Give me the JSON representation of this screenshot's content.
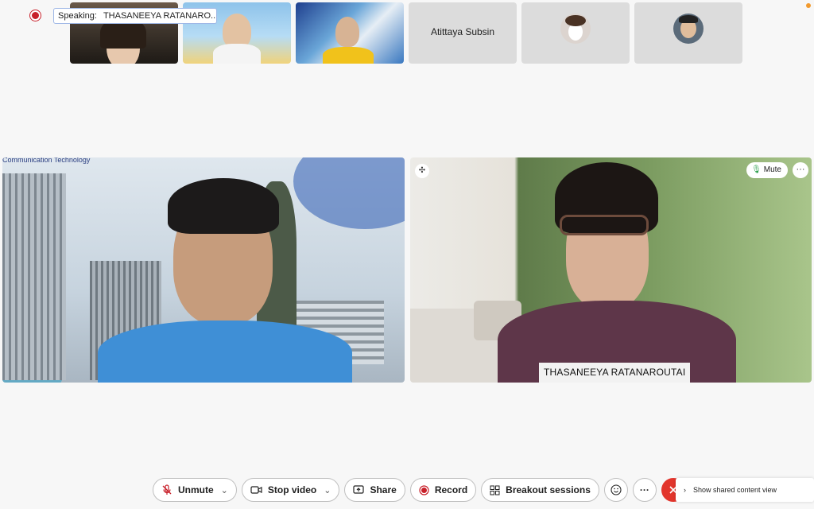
{
  "app": {
    "recording_indicator": "record-dot-icon",
    "accent_color": "#c8202a",
    "end_color": "#e2352c"
  },
  "speaking": {
    "label": "Speaking:",
    "name": "THASANEEYA RATANARO..."
  },
  "filmstrip": {
    "tiles": [
      {
        "type": "video"
      },
      {
        "type": "video"
      },
      {
        "type": "video"
      },
      {
        "type": "name",
        "name": "Atittaya Subsin"
      },
      {
        "type": "avatar"
      },
      {
        "type": "avatar"
      }
    ]
  },
  "main": {
    "left_tile": {
      "banner_text": "Communication Technology"
    },
    "right_tile": {
      "participant_name": "THASANEEYA RATANAROUTAI",
      "mute_label": "Mute",
      "more_label": "···"
    }
  },
  "controls": {
    "unmute": "Unmute",
    "stop_video": "Stop video",
    "share": "Share",
    "record": "Record",
    "breakout": "Breakout sessions",
    "more": "···"
  },
  "side_panel": {
    "label": "Show shared content view"
  }
}
